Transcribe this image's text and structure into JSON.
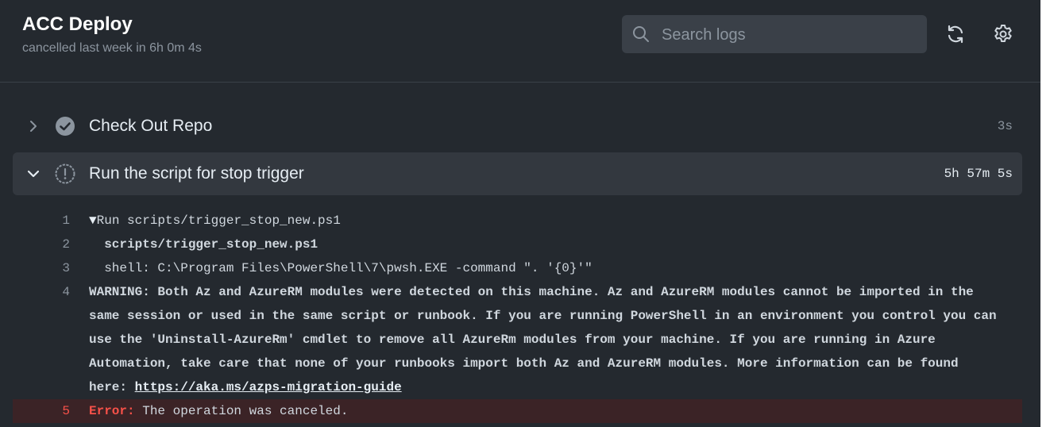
{
  "header": {
    "title": "ACC Deploy",
    "subtitle": "cancelled last week in 6h 0m 4s",
    "search_placeholder": "Search logs"
  },
  "steps": [
    {
      "name": "Check Out Repo",
      "duration": "3s",
      "status": "success",
      "expanded": false
    },
    {
      "name": "Run the script for stop trigger",
      "duration": "5h 57m 5s",
      "status": "cancelled",
      "expanded": true
    }
  ],
  "log": {
    "lines": [
      {
        "num": "1",
        "text": "Run scripts/trigger_stop_new.ps1"
      },
      {
        "num": "2",
        "text": "  scripts/trigger_stop_new.ps1"
      },
      {
        "num": "3",
        "text": "  shell: C:\\Program Files\\PowerShell\\7\\pwsh.EXE -command \". '{0}'\""
      },
      {
        "num": "4",
        "text": "WARNING: Both Az and AzureRM modules were detected on this machine. Az and AzureRM modules cannot be imported in the same session or used in the same script or runbook. If you are running PowerShell in an environment you control you can use the 'Uninstall-AzureRm' cmdlet to remove all AzureRm modules from your machine. If you are running in Azure Automation, take care that none of your runbooks import both Az and AzureRM modules. More information can be found here: ",
        "link": "https://aka.ms/azps-migration-guide"
      },
      {
        "num": "5",
        "label": "Error:",
        "text": " The operation was canceled."
      }
    ]
  },
  "colors": {
    "panel_bg": "#24292f",
    "expanded_step_bg": "#33383f",
    "warning": "#d29922",
    "error": "#f85149",
    "path_highlight": "#39c5cf"
  }
}
